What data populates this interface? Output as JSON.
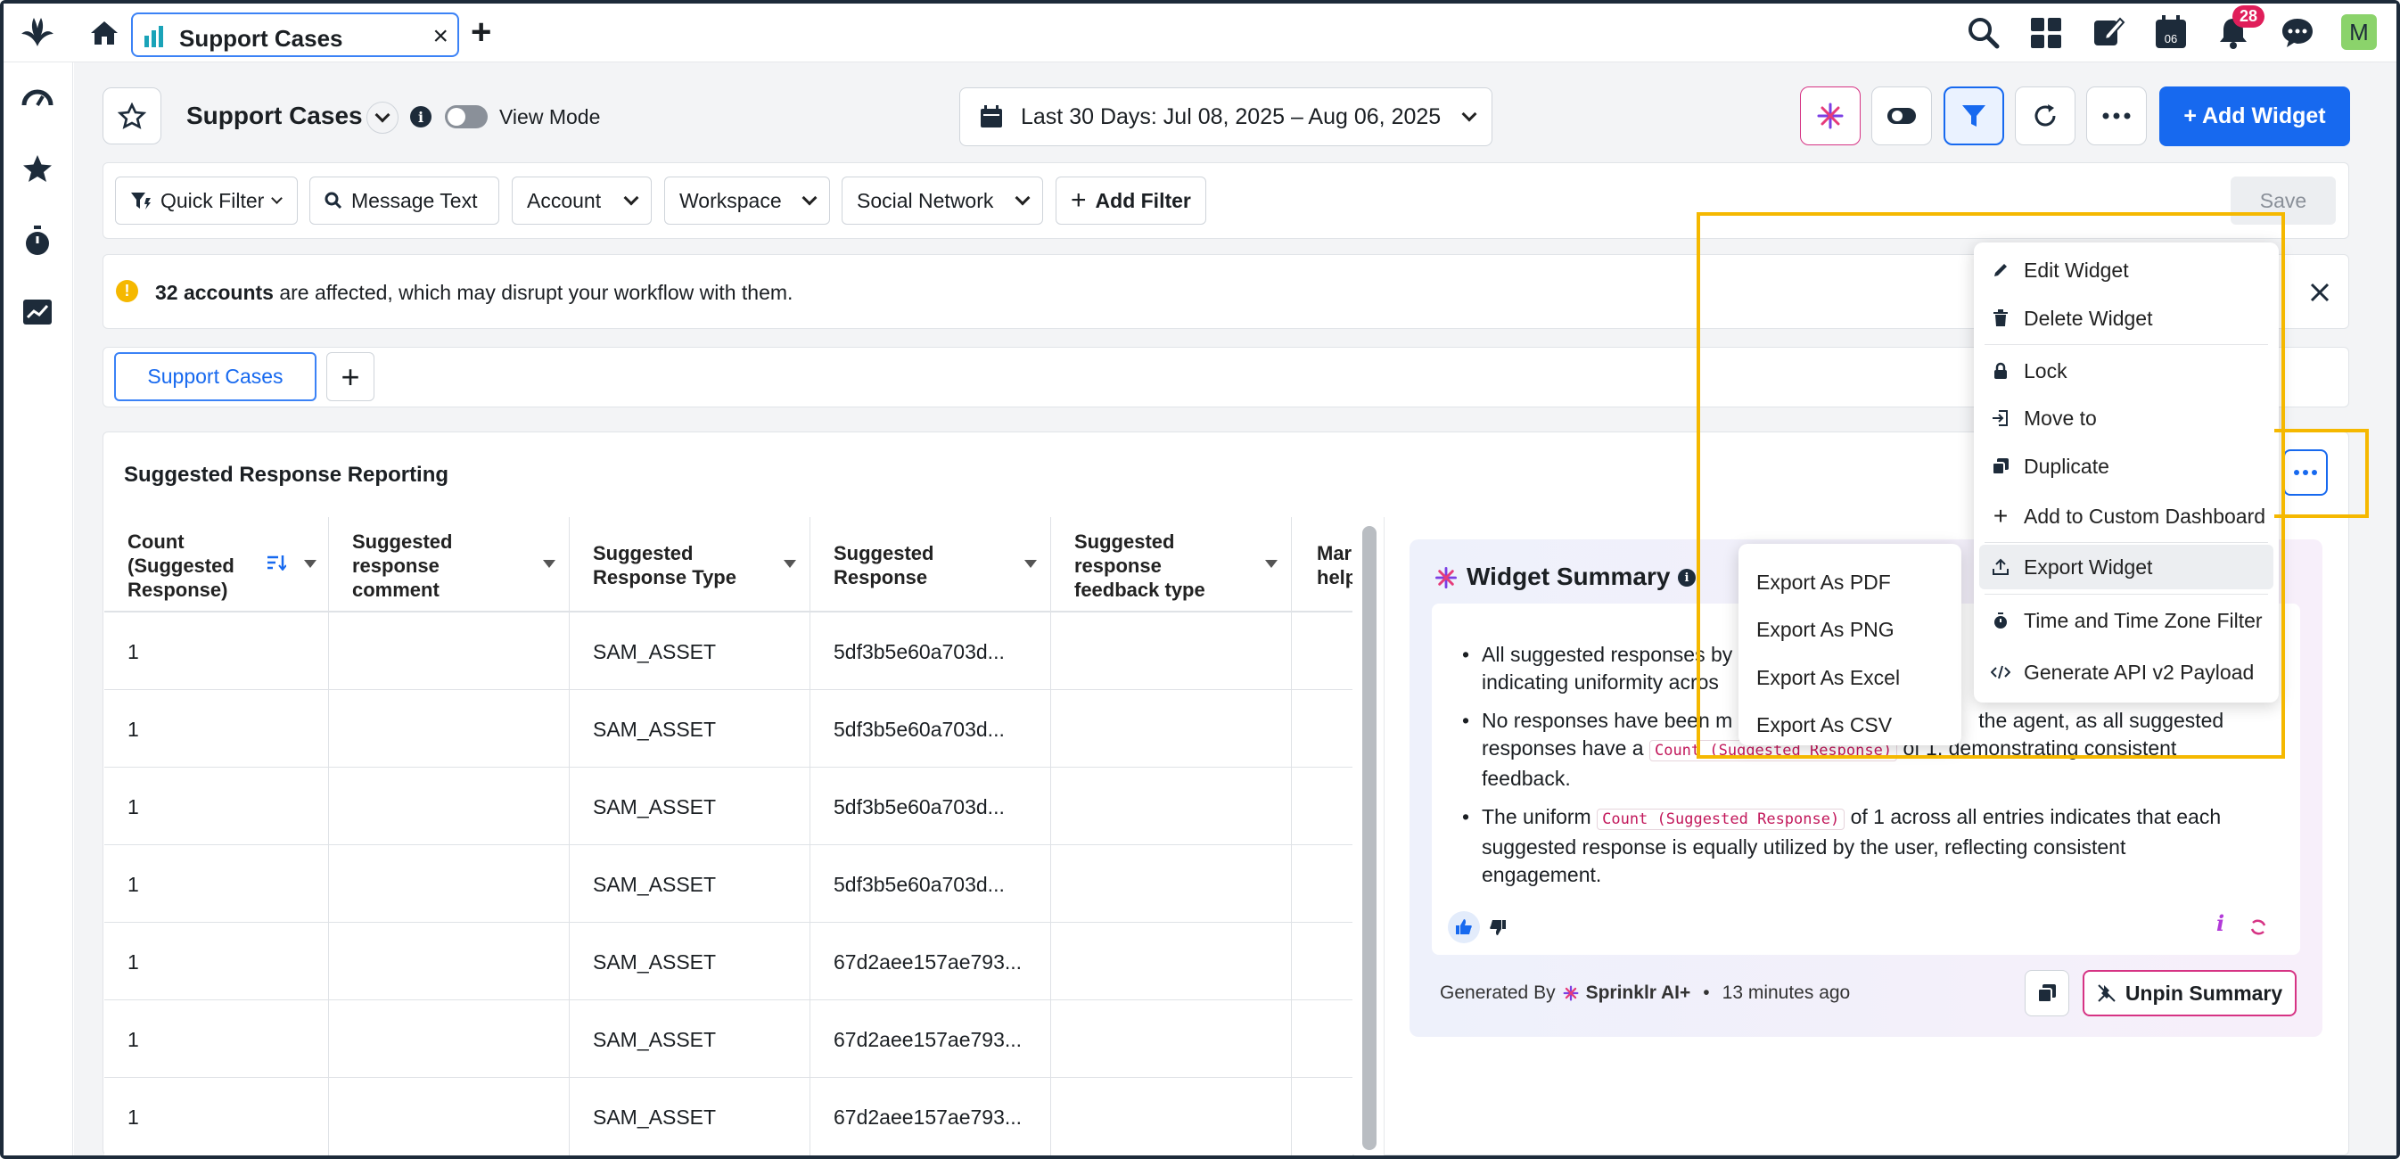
{
  "tab": {
    "title": "Support Cases"
  },
  "notifications": {
    "count": "28"
  },
  "avatar": {
    "initial": "M"
  },
  "dashboard": {
    "title": "Support Cases",
    "view_mode_label": "View Mode",
    "date_range": "Last 30 Days: Jul 08, 2025 – Aug 06, 2025",
    "add_widget_label": "+ Add Widget"
  },
  "filters": {
    "quick_filter": "Quick Filter",
    "message_text": "Message Text",
    "account": "Account",
    "workspace": "Workspace",
    "social_network": "Social Network",
    "add_filter": "Add Filter",
    "save": "Save"
  },
  "alert": {
    "count_text": "32 accounts",
    "rest": "are affected, which may disrupt your workflow with them."
  },
  "subtabs": {
    "active": "Support Cases"
  },
  "widget": {
    "title": "Suggested Response Reporting",
    "columns": [
      "Count (Suggested Response)",
      "Suggested response comment",
      "Suggested Response Type",
      "Suggested Response",
      "Suggested response feedback type",
      "Marl help"
    ],
    "rows": [
      {
        "count": "1",
        "comment": "",
        "type": "SAM_ASSET",
        "response": "5df3b5e60a703d...",
        "feedback": ""
      },
      {
        "count": "1",
        "comment": "",
        "type": "SAM_ASSET",
        "response": "5df3b5e60a703d...",
        "feedback": ""
      },
      {
        "count": "1",
        "comment": "",
        "type": "SAM_ASSET",
        "response": "5df3b5e60a703d...",
        "feedback": ""
      },
      {
        "count": "1",
        "comment": "",
        "type": "SAM_ASSET",
        "response": "5df3b5e60a703d...",
        "feedback": ""
      },
      {
        "count": "1",
        "comment": "",
        "type": "SAM_ASSET",
        "response": "67d2aee157ae793...",
        "feedback": ""
      },
      {
        "count": "1",
        "comment": "",
        "type": "SAM_ASSET",
        "response": "67d2aee157ae793...",
        "feedback": ""
      },
      {
        "count": "1",
        "comment": "",
        "type": "SAM_ASSET",
        "response": "67d2aee157ae793...",
        "feedback": ""
      }
    ]
  },
  "summary": {
    "title": "Widget Summary",
    "bullet1_a": "All suggested responses by",
    "bullet1_b": "indicating uniformity acros",
    "bullet2_a": "No responses have been m",
    "bullet2_b": "the agent, as all suggested",
    "bullet2_c": "responses have a",
    "bullet2_code": "Count (Suggested Response)",
    "bullet2_d": "of 1, demonstrating consistent",
    "bullet2_e": "feedback.",
    "bullet3_a": "The uniform",
    "bullet3_code": "Count (Suggested Response)",
    "bullet3_b": "of 1 across all entries indicates that each",
    "bullet3_c": "suggested response is equally utilized by the user, reflecting consistent",
    "bullet3_d": "engagement.",
    "generated_by": "Generated By",
    "brand": "Sprinklr AI+",
    "time_ago": "13 minutes ago",
    "unpin_label": "Unpin Summary"
  },
  "widget_menu": {
    "items": [
      "Edit Widget",
      "Delete Widget",
      "Lock",
      "Move to",
      "Duplicate",
      "Add to Custom Dashboard",
      "Export Widget",
      "Time and Time Zone Filter",
      "Generate API v2 Payload"
    ]
  },
  "export_menu": {
    "items": [
      "Export As PDF",
      "Export As PNG",
      "Export As Excel",
      "Export As CSV"
    ]
  },
  "colors": {
    "primary": "#1769ef",
    "highlight_box": "#f5b800",
    "badge": "#e01e5a",
    "ai_pink": "#d63384"
  }
}
